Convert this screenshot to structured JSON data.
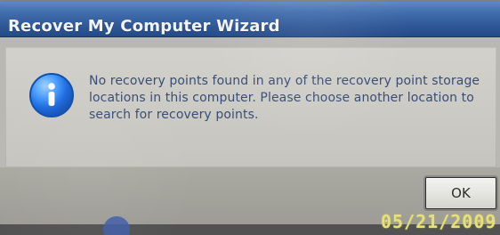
{
  "window": {
    "title": "Recover My Computer Wizard",
    "icon": "information-icon"
  },
  "dialog": {
    "message": "No recovery points found in any of the recovery point storage\nlocations in this computer. Please choose another location to\nsearch for recovery points.",
    "ok_label": "OK"
  },
  "overlay": {
    "date_stamp": "05/21/2009"
  },
  "colors": {
    "title_bar": "#2e5696",
    "dialog_background": "#b9b8b2",
    "message_text": "#3a4d74",
    "date_stamp": "#e6e07c"
  }
}
